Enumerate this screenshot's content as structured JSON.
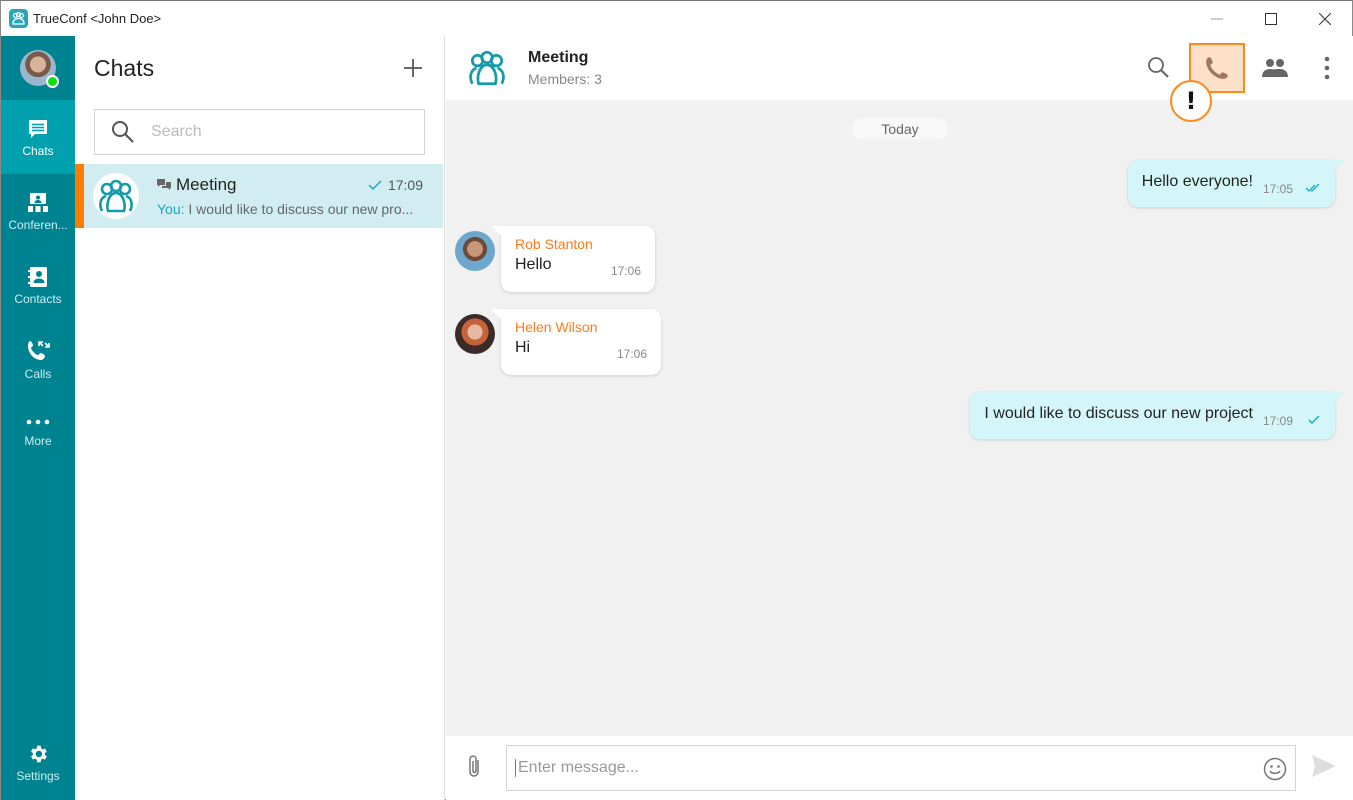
{
  "window": {
    "title": "TrueConf <John Doe>",
    "controls": {
      "minimize": "minimize-icon",
      "maximize": "maximize-icon",
      "close": "close-icon"
    }
  },
  "nav": {
    "profile": {
      "status": "online",
      "status_color": "#10e010"
    },
    "items": [
      {
        "label": "Chats",
        "icon": "chat-bubble-icon",
        "active": true
      },
      {
        "label": "Conferen...",
        "icon": "conference-icon",
        "active": false
      },
      {
        "label": "Contacts",
        "icon": "contacts-book-icon",
        "active": false
      },
      {
        "label": "Calls",
        "icon": "phone-calls-icon",
        "active": false
      },
      {
        "label": "More",
        "icon": "more-dots-icon",
        "active": false
      }
    ],
    "settings": {
      "label": "Settings",
      "icon": "gear-icon"
    }
  },
  "chats": {
    "title": "Chats",
    "new_chat_icon": "plus-icon",
    "search_placeholder": "Search",
    "list": [
      {
        "name": "Meeting",
        "type_icon": "group-chat-icon",
        "time": "17:09",
        "status": "sent",
        "preview_prefix": "You:",
        "preview": "I would like to discuss our new pro...",
        "selected": true
      }
    ]
  },
  "conversation": {
    "name": "Meeting",
    "members": "Members: 3",
    "actions": [
      "search-icon",
      "phone-icon",
      "participants-icon",
      "more-vertical-icon"
    ],
    "highlighted_action": "phone-icon",
    "alert_mark": "!",
    "date_separator": "Today",
    "messages": [
      {
        "direction": "out",
        "text": "Hello everyone!",
        "time": "17:05",
        "status": "read"
      },
      {
        "direction": "in",
        "sender": "Rob Stanton",
        "text": "Hello",
        "time": "17:06"
      },
      {
        "direction": "in",
        "sender": "Helen Wilson",
        "text": "Hi",
        "time": "17:06"
      },
      {
        "direction": "out",
        "text": "I would like to discuss our new project",
        "time": "17:09",
        "status": "sent"
      }
    ],
    "composer": {
      "placeholder": "Enter message...",
      "value": ""
    }
  },
  "colors": {
    "nav_bg": "#008390",
    "nav_active": "#00a0af",
    "accent_orange": "#ff7a00",
    "selected_chat_bg": "#d1edf2",
    "outgoing_bubble": "#d5f6f8",
    "sender_name": "#ff7a1a",
    "highlight_bg": "#fde0c8"
  }
}
